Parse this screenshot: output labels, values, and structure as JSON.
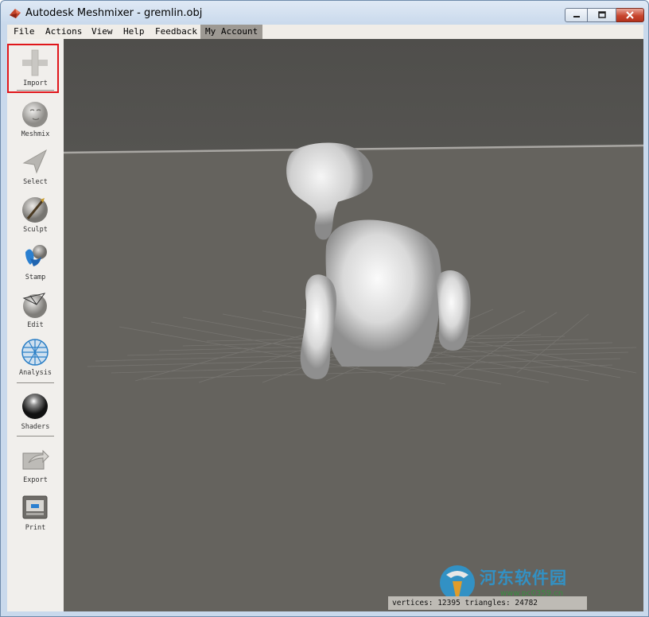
{
  "window": {
    "title": "Autodesk Meshmixer - gremlin.obj",
    "minimize_label": "minimize",
    "maximize_label": "maximize",
    "close_label": "close"
  },
  "menu": {
    "items": [
      "File",
      "Actions",
      "View",
      "Help",
      "Feedback",
      "My Account"
    ]
  },
  "toolbar": {
    "tools": [
      {
        "label": "Import",
        "icon": "plus-icon"
      },
      {
        "label": "Meshmix",
        "icon": "meshmix-ball-icon"
      },
      {
        "label": "Select",
        "icon": "select-arrow-icon"
      },
      {
        "label": "Sculpt",
        "icon": "sculpt-brush-icon"
      },
      {
        "label": "Stamp",
        "icon": "stamp-icon"
      },
      {
        "label": "Edit",
        "icon": "edit-mesh-icon"
      },
      {
        "label": "Analysis",
        "icon": "analysis-sphere-icon"
      },
      {
        "label": "Shaders",
        "icon": "shader-sphere-icon"
      },
      {
        "label": "Export",
        "icon": "export-folder-icon"
      },
      {
        "label": "Print",
        "icon": "printer-icon"
      }
    ]
  },
  "status": {
    "text": "vertices: 12395 triangles: 24782"
  },
  "watermark": {
    "text": "河东软件园",
    "url": "www.pc0359.cn"
  },
  "colors": {
    "viewport_bg": "#65635e",
    "sky": "#4f4e4b",
    "highlight": "#e0161b",
    "model": "#e8e8e8"
  }
}
